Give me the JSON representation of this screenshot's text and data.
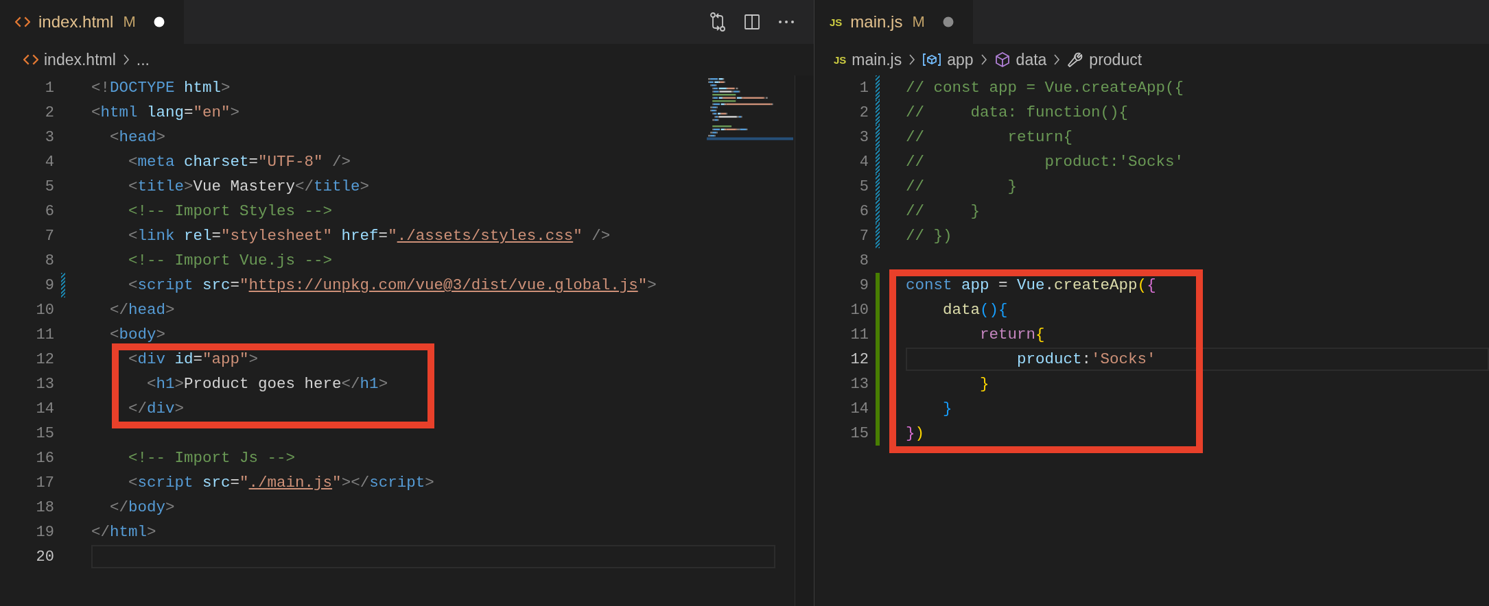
{
  "editors": [
    {
      "focused": true,
      "minimap": true,
      "tab": {
        "label": "index.html",
        "status": "M",
        "dirty": true,
        "selected": true
      },
      "actions": [
        {
          "kind": "compare"
        },
        {
          "kind": "split"
        },
        {
          "kind": "more"
        }
      ],
      "breadcrumbs": [
        {
          "kind": "html-file",
          "label": "index.html"
        },
        {
          "kind": "text",
          "label": "..."
        }
      ],
      "sections": [
        {
          "kind": "plain",
          "lines": [
            {
              "number": "1",
              "current": false,
              "kind": "plain",
              "tokens": [
                {
                  "kind": "punct",
                  "text": "<!"
                },
                {
                  "kind": "tag",
                  "text": "DOCTYPE"
                },
                {
                  "kind": "attr",
                  "text": " html"
                },
                {
                  "kind": "punct",
                  "text": ">"
                }
              ]
            },
            {
              "number": "2",
              "current": false,
              "kind": "plain",
              "tokens": [
                {
                  "kind": "punct",
                  "text": "<"
                },
                {
                  "kind": "tag",
                  "text": "html"
                },
                {
                  "kind": "attr",
                  "text": " lang"
                },
                {
                  "kind": "text",
                  "text": "="
                },
                {
                  "kind": "string",
                  "text": "\"en\""
                },
                {
                  "kind": "punct",
                  "text": ">"
                }
              ]
            },
            {
              "number": "3",
              "current": false,
              "kind": "plain",
              "tokens": [
                {
                  "kind": "punct",
                  "text": "  <"
                },
                {
                  "kind": "tag",
                  "text": "head"
                },
                {
                  "kind": "punct",
                  "text": ">"
                }
              ]
            },
            {
              "number": "4",
              "current": false,
              "kind": "plain",
              "tokens": [
                {
                  "kind": "punct",
                  "text": "    <"
                },
                {
                  "kind": "tag",
                  "text": "meta"
                },
                {
                  "kind": "attr",
                  "text": " charset"
                },
                {
                  "kind": "text",
                  "text": "="
                },
                {
                  "kind": "string",
                  "text": "\"UTF-8\""
                },
                {
                  "kind": "punct",
                  "text": " />"
                }
              ]
            },
            {
              "number": "5",
              "current": false,
              "kind": "plain",
              "tokens": [
                {
                  "kind": "punct",
                  "text": "    <"
                },
                {
                  "kind": "tag",
                  "text": "title"
                },
                {
                  "kind": "punct",
                  "text": ">"
                },
                {
                  "kind": "text",
                  "text": "Vue Mastery"
                },
                {
                  "kind": "punct",
                  "text": "</"
                },
                {
                  "kind": "tag",
                  "text": "title"
                },
                {
                  "kind": "punct",
                  "text": ">"
                }
              ]
            },
            {
              "number": "6",
              "current": false,
              "kind": "plain",
              "tokens": [
                {
                  "kind": "comment",
                  "text": "    <!-- Import Styles -->"
                }
              ]
            },
            {
              "number": "7",
              "current": false,
              "kind": "plain",
              "tokens": [
                {
                  "kind": "punct",
                  "text": "    <"
                },
                {
                  "kind": "tag",
                  "text": "link"
                },
                {
                  "kind": "attr",
                  "text": " rel"
                },
                {
                  "kind": "text",
                  "text": "="
                },
                {
                  "kind": "string",
                  "text": "\"stylesheet\""
                },
                {
                  "kind": "attr",
                  "text": " href"
                },
                {
                  "kind": "text",
                  "text": "="
                },
                {
                  "kind": "string",
                  "text": "\""
                },
                {
                  "kind": "link",
                  "text": "./assets/styles.css"
                },
                {
                  "kind": "string",
                  "text": "\""
                },
                {
                  "kind": "punct",
                  "text": " />"
                }
              ]
            },
            {
              "number": "8",
              "current": false,
              "kind": "plain",
              "tokens": [
                {
                  "kind": "comment",
                  "text": "    <!-- Import Vue.js -->"
                }
              ]
            },
            {
              "number": "9",
              "current": false,
              "kind": "modified",
              "tokens": [
                {
                  "kind": "punct",
                  "text": "    <"
                },
                {
                  "kind": "tag",
                  "text": "script"
                },
                {
                  "kind": "attr",
                  "text": " src"
                },
                {
                  "kind": "text",
                  "text": "="
                },
                {
                  "kind": "string",
                  "text": "\""
                },
                {
                  "kind": "link",
                  "text": "https://unpkg.com/vue@3/dist/vue.global.js"
                },
                {
                  "kind": "string",
                  "text": "\""
                },
                {
                  "kind": "punct",
                  "text": ">"
                }
              ]
            },
            {
              "number": "10",
              "current": false,
              "kind": "plain",
              "tokens": [
                {
                  "kind": "punct",
                  "text": "  </"
                },
                {
                  "kind": "tag",
                  "text": "head"
                },
                {
                  "kind": "punct",
                  "text": ">"
                }
              ]
            },
            {
              "number": "11",
              "current": false,
              "kind": "plain",
              "tokens": [
                {
                  "kind": "punct",
                  "text": "  <"
                },
                {
                  "kind": "tag",
                  "text": "body"
                },
                {
                  "kind": "punct",
                  "text": ">"
                }
              ]
            }
          ]
        },
        {
          "kind": "highlighted",
          "lines": [
            {
              "number": "12",
              "current": false,
              "kind": "plain",
              "tokens": [
                {
                  "kind": "punct",
                  "text": "    <"
                },
                {
                  "kind": "tag",
                  "text": "div"
                },
                {
                  "kind": "attr",
                  "text": " id"
                },
                {
                  "kind": "text",
                  "text": "="
                },
                {
                  "kind": "string",
                  "text": "\"app\""
                },
                {
                  "kind": "punct",
                  "text": ">"
                }
              ]
            },
            {
              "number": "13",
              "current": false,
              "kind": "plain",
              "tokens": [
                {
                  "kind": "punct",
                  "text": "      <"
                },
                {
                  "kind": "tag",
                  "text": "h1"
                },
                {
                  "kind": "punct",
                  "text": ">"
                },
                {
                  "kind": "text",
                  "text": "Product goes here"
                },
                {
                  "kind": "punct",
                  "text": "</"
                },
                {
                  "kind": "tag",
                  "text": "h1"
                },
                {
                  "kind": "punct",
                  "text": ">"
                }
              ]
            },
            {
              "number": "14",
              "current": false,
              "kind": "plain",
              "tokens": [
                {
                  "kind": "punct",
                  "text": "    </"
                },
                {
                  "kind": "tag",
                  "text": "div"
                },
                {
                  "kind": "punct",
                  "text": ">"
                }
              ]
            }
          ]
        },
        {
          "kind": "plain",
          "lines": [
            {
              "number": "15",
              "current": false,
              "kind": "plain"
            },
            {
              "number": "16",
              "current": false,
              "kind": "plain",
              "tokens": [
                {
                  "kind": "comment",
                  "text": "    <!-- Import Js -->"
                }
              ]
            },
            {
              "number": "17",
              "current": false,
              "kind": "plain",
              "tokens": [
                {
                  "kind": "punct",
                  "text": "    <"
                },
                {
                  "kind": "tag",
                  "text": "script"
                },
                {
                  "kind": "attr",
                  "text": " src"
                },
                {
                  "kind": "text",
                  "text": "="
                },
                {
                  "kind": "string",
                  "text": "\""
                },
                {
                  "kind": "link",
                  "text": "./main.js"
                },
                {
                  "kind": "string",
                  "text": "\""
                },
                {
                  "kind": "punct",
                  "text": "></"
                },
                {
                  "kind": "tag",
                  "text": "script"
                },
                {
                  "kind": "punct",
                  "text": ">"
                }
              ]
            },
            {
              "number": "18",
              "current": false,
              "kind": "plain",
              "tokens": [
                {
                  "kind": "punct",
                  "text": "  </"
                },
                {
                  "kind": "tag",
                  "text": "body"
                },
                {
                  "kind": "punct",
                  "text": ">"
                }
              ]
            },
            {
              "number": "19",
              "current": false,
              "kind": "plain",
              "tokens": [
                {
                  "kind": "punct",
                  "text": "</"
                },
                {
                  "kind": "tag",
                  "text": "html"
                },
                {
                  "kind": "punct",
                  "text": ">"
                }
              ]
            },
            {
              "number": "20",
              "current": true,
              "kind": "plain"
            }
          ]
        }
      ]
    },
    {
      "focused": false,
      "tab": {
        "icon_text": "JS",
        "label": "main.js",
        "status": "M",
        "dirty": true,
        "selected": true
      },
      "breadcrumbs": [
        {
          "kind": "js-file",
          "icon_text": "JS",
          "label": "main.js"
        },
        {
          "kind": "variable",
          "label": "app"
        },
        {
          "kind": "module",
          "label": "data"
        },
        {
          "kind": "property",
          "label": "product"
        }
      ],
      "sections": [
        {
          "kind": "plain",
          "lines": [
            {
              "number": "1",
              "current": false,
              "kind": "modified",
              "tokens": [
                {
                  "kind": "comment",
                  "text": "// const app = Vue.createApp({"
                }
              ]
            },
            {
              "number": "2",
              "current": false,
              "kind": "modified",
              "tokens": [
                {
                  "kind": "comment",
                  "text": "//     data: function(){"
                }
              ]
            },
            {
              "number": "3",
              "current": false,
              "kind": "modified",
              "tokens": [
                {
                  "kind": "comment",
                  "text": "//         return{"
                }
              ]
            },
            {
              "number": "4",
              "current": false,
              "kind": "modified",
              "tokens": [
                {
                  "kind": "comment",
                  "text": "//             product:'Socks'"
                }
              ]
            },
            {
              "number": "5",
              "current": false,
              "kind": "modified",
              "tokens": [
                {
                  "kind": "comment",
                  "text": "//         }"
                }
              ]
            },
            {
              "number": "6",
              "current": false,
              "kind": "modified",
              "tokens": [
                {
                  "kind": "comment",
                  "text": "//     }"
                }
              ]
            },
            {
              "number": "7",
              "current": false,
              "kind": "modified",
              "tokens": [
                {
                  "kind": "comment",
                  "text": "// })"
                }
              ]
            },
            {
              "number": "8",
              "current": false,
              "kind": "plain"
            }
          ]
        },
        {
          "kind": "highlighted",
          "lines": [
            {
              "number": "9",
              "current": false,
              "kind": "added",
              "tokens": [
                {
                  "kind": "keyword",
                  "text": "const"
                },
                {
                  "kind": "variable",
                  "text": " app"
                },
                {
                  "kind": "text",
                  "text": " = "
                },
                {
                  "kind": "variable",
                  "text": "Vue"
                },
                {
                  "kind": "text",
                  "text": "."
                },
                {
                  "kind": "function",
                  "text": "createApp"
                },
                {
                  "kind": "bracket1",
                  "text": "("
                },
                {
                  "kind": "bracket2",
                  "text": "{"
                }
              ]
            },
            {
              "number": "10",
              "current": false,
              "kind": "added",
              "tokens": [
                {
                  "kind": "function",
                  "text": "    data"
                },
                {
                  "kind": "bracket3",
                  "text": "(){"
                }
              ]
            },
            {
              "number": "11",
              "current": false,
              "kind": "added",
              "tokens": [
                {
                  "kind": "control",
                  "text": "        return"
                },
                {
                  "kind": "bracket1",
                  "text": "{"
                }
              ]
            },
            {
              "number": "12",
              "current": true,
              "kind": "added",
              "tokens": [
                {
                  "kind": "variable",
                  "text": "            product"
                },
                {
                  "kind": "text",
                  "text": ":"
                },
                {
                  "kind": "string",
                  "text": "'Socks'"
                }
              ]
            },
            {
              "number": "13",
              "current": false,
              "kind": "added",
              "tokens": [
                {
                  "kind": "bracket1",
                  "text": "        }"
                }
              ]
            },
            {
              "number": "14",
              "current": false,
              "kind": "added",
              "tokens": [
                {
                  "kind": "bracket3",
                  "text": "    }"
                }
              ]
            },
            {
              "number": "15",
              "current": false,
              "kind": "added",
              "tokens": [
                {
                  "kind": "bracket2",
                  "text": "}"
                },
                {
                  "kind": "bracket1",
                  "text": ")"
                }
              ]
            }
          ]
        }
      ]
    }
  ]
}
